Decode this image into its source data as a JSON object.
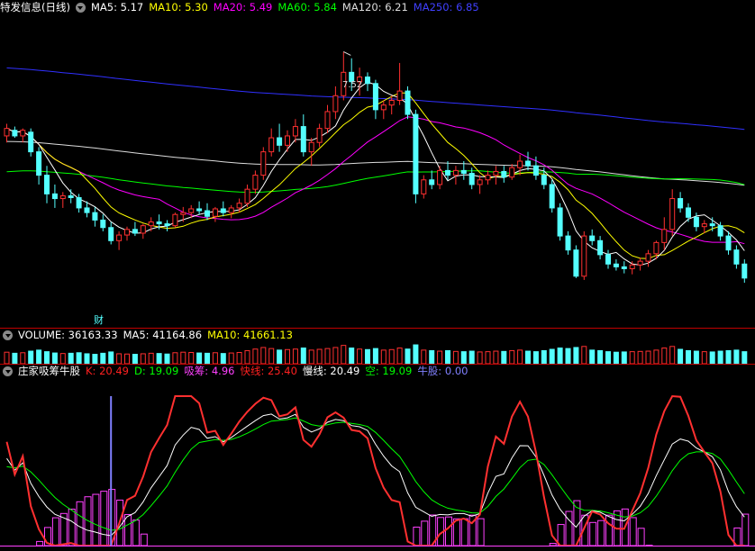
{
  "main_header": {
    "stock_name": "特发信息",
    "period": "(日线)",
    "ma": [
      {
        "label": "MA5: 5.17",
        "color": "#ffffff"
      },
      {
        "label": "MA10: 5.30",
        "color": "#ffff00"
      },
      {
        "label": "MA20: 5.49",
        "color": "#ff00ff"
      },
      {
        "label": "MA60: 5.84",
        "color": "#00ff00"
      },
      {
        "label": "MA120: 6.21",
        "color": "#dddddd"
      },
      {
        "label": "MA250: 6.85",
        "color": "#4040ff"
      }
    ]
  },
  "high_marker": "7.52",
  "finance_marker": "财",
  "volume_header": [
    {
      "label": "VOLUME: 36163.33",
      "color": "#ffffff"
    },
    {
      "label": "MA5: 41164.86",
      "color": "#ffffff"
    },
    {
      "label": "MA10: 41661.13",
      "color": "#ffff00"
    }
  ],
  "indicator_header": [
    {
      "label": "庄家吸筹牛股",
      "color": "#ffffff"
    },
    {
      "label": "K: 20.49",
      "color": "#ff2020"
    },
    {
      "label": "D: 19.09",
      "color": "#00ff00"
    },
    {
      "label": "吸筹: 4.96",
      "color": "#ff40ff"
    },
    {
      "label": "快线: 25.40",
      "color": "#ff2020"
    },
    {
      "label": "慢线: 20.49",
      "color": "#ffffff"
    },
    {
      "label": "空: 19.09",
      "color": "#00ff00"
    },
    {
      "label": "牛股: 0.00",
      "color": "#8080ff"
    }
  ],
  "colors": {
    "up": "#ff3030",
    "down": "#54ffff",
    "border": "#c00000",
    "ma5": "#ffffff",
    "ma10": "#ffff00",
    "ma20": "#ff00ff",
    "ma60": "#00ff00",
    "ma120": "#dddddd",
    "ma250": "#3030ff",
    "bull": "#8080ff",
    "absorb": "#ff40ff"
  },
  "chart_data": {
    "type": "candlestick",
    "candles": [
      [
        6.62,
        6.75,
        6.55,
        6.7
      ],
      [
        6.68,
        6.72,
        6.6,
        6.62
      ],
      [
        6.62,
        6.7,
        6.55,
        6.68
      ],
      [
        6.66,
        6.7,
        6.4,
        6.45
      ],
      [
        6.45,
        6.5,
        6.1,
        6.2
      ],
      [
        6.2,
        6.3,
        5.9,
        6.0
      ],
      [
        6.0,
        6.1,
        5.85,
        5.95
      ],
      [
        5.95,
        6.02,
        5.85,
        5.98
      ],
      [
        5.98,
        6.05,
        5.9,
        5.96
      ],
      [
        5.96,
        6.0,
        5.8,
        5.85
      ],
      [
        5.85,
        5.92,
        5.75,
        5.8
      ],
      [
        5.8,
        5.86,
        5.65,
        5.72
      ],
      [
        5.72,
        5.78,
        5.6,
        5.64
      ],
      [
        5.64,
        5.7,
        5.46,
        5.5
      ],
      [
        5.5,
        5.6,
        5.4,
        5.56
      ],
      [
        5.56,
        5.65,
        5.5,
        5.62
      ],
      [
        5.62,
        5.7,
        5.55,
        5.58
      ],
      [
        5.58,
        5.68,
        5.52,
        5.66
      ],
      [
        5.66,
        5.75,
        5.6,
        5.7
      ],
      [
        5.7,
        5.78,
        5.62,
        5.68
      ],
      [
        5.68,
        5.72,
        5.6,
        5.66
      ],
      [
        5.66,
        5.8,
        5.64,
        5.78
      ],
      [
        5.78,
        5.86,
        5.7,
        5.8
      ],
      [
        5.8,
        5.88,
        5.74,
        5.84
      ],
      [
        5.84,
        5.92,
        5.78,
        5.82
      ],
      [
        5.82,
        5.9,
        5.72,
        5.76
      ],
      [
        5.76,
        5.86,
        5.7,
        5.84
      ],
      [
        5.84,
        5.92,
        5.76,
        5.8
      ],
      [
        5.8,
        5.88,
        5.74,
        5.85
      ],
      [
        5.85,
        5.95,
        5.8,
        5.9
      ],
      [
        5.9,
        6.1,
        5.86,
        6.05
      ],
      [
        6.05,
        6.25,
        6.0,
        6.2
      ],
      [
        6.2,
        6.5,
        6.15,
        6.45
      ],
      [
        6.45,
        6.7,
        6.4,
        6.6
      ],
      [
        6.6,
        6.75,
        6.45,
        6.52
      ],
      [
        6.52,
        6.68,
        6.45,
        6.62
      ],
      [
        6.62,
        6.8,
        6.55,
        6.72
      ],
      [
        6.72,
        6.85,
        6.4,
        6.45
      ],
      [
        6.45,
        6.6,
        6.3,
        6.55
      ],
      [
        6.55,
        6.75,
        6.5,
        6.7
      ],
      [
        6.7,
        6.95,
        6.65,
        6.88
      ],
      [
        6.88,
        7.15,
        6.8,
        7.05
      ],
      [
        7.05,
        7.52,
        7.0,
        7.3
      ],
      [
        7.3,
        7.45,
        7.1,
        7.2
      ],
      [
        7.2,
        7.35,
        7.05,
        7.25
      ],
      [
        7.25,
        7.3,
        7.1,
        7.18
      ],
      [
        7.18,
        7.22,
        6.8,
        6.9
      ],
      [
        6.9,
        7.0,
        6.8,
        6.95
      ],
      [
        6.95,
        7.05,
        6.85,
        7.0
      ],
      [
        7.0,
        7.4,
        6.95,
        7.1
      ],
      [
        7.1,
        7.15,
        6.8,
        6.85
      ],
      [
        6.85,
        6.9,
        5.9,
        6.0
      ],
      [
        6.0,
        6.2,
        5.95,
        6.15
      ],
      [
        6.15,
        6.25,
        6.05,
        6.1
      ],
      [
        6.1,
        6.3,
        6.05,
        6.25
      ],
      [
        6.25,
        6.35,
        6.15,
        6.2
      ],
      [
        6.2,
        6.3,
        6.1,
        6.25
      ],
      [
        6.25,
        6.35,
        6.15,
        6.22
      ],
      [
        6.22,
        6.28,
        6.05,
        6.1
      ],
      [
        6.1,
        6.2,
        6.0,
        6.15
      ],
      [
        6.15,
        6.25,
        6.1,
        6.2
      ],
      [
        6.2,
        6.3,
        6.1,
        6.24
      ],
      [
        6.24,
        6.3,
        6.12,
        6.18
      ],
      [
        6.18,
        6.32,
        6.15,
        6.28
      ],
      [
        6.28,
        6.42,
        6.2,
        6.35
      ],
      [
        6.35,
        6.45,
        6.25,
        6.3
      ],
      [
        6.3,
        6.4,
        6.15,
        6.2
      ],
      [
        6.2,
        6.28,
        6.05,
        6.1
      ],
      [
        6.1,
        6.15,
        5.8,
        5.85
      ],
      [
        5.85,
        5.9,
        5.5,
        5.55
      ],
      [
        5.55,
        5.6,
        5.35,
        5.4
      ],
      [
        5.4,
        5.45,
        5.1,
        5.12
      ],
      [
        5.12,
        5.6,
        5.08,
        5.55
      ],
      [
        5.55,
        5.62,
        5.45,
        5.5
      ],
      [
        5.5,
        5.55,
        5.3,
        5.35
      ],
      [
        5.35,
        5.4,
        5.2,
        5.25
      ],
      [
        5.25,
        5.3,
        5.18,
        5.22
      ],
      [
        5.22,
        5.28,
        5.15,
        5.2
      ],
      [
        5.2,
        5.28,
        5.14,
        5.24
      ],
      [
        5.24,
        5.32,
        5.18,
        5.28
      ],
      [
        5.28,
        5.4,
        5.22,
        5.36
      ],
      [
        5.36,
        5.5,
        5.3,
        5.48
      ],
      [
        5.48,
        5.75,
        5.4,
        5.62
      ],
      [
        5.62,
        6.05,
        5.55,
        5.95
      ],
      [
        5.95,
        6.02,
        5.8,
        5.85
      ],
      [
        5.85,
        5.9,
        5.7,
        5.75
      ],
      [
        5.75,
        5.8,
        5.6,
        5.65
      ],
      [
        5.65,
        5.72,
        5.58,
        5.68
      ],
      [
        5.68,
        5.75,
        5.6,
        5.66
      ],
      [
        5.66,
        5.7,
        5.5,
        5.55
      ],
      [
        5.55,
        5.6,
        5.35,
        5.4
      ],
      [
        5.4,
        5.45,
        5.2,
        5.25
      ],
      [
        5.25,
        5.3,
        5.05,
        5.1
      ]
    ],
    "volume": [
      44,
      40,
      42,
      48,
      52,
      46,
      41,
      39,
      40,
      42,
      38,
      36,
      40,
      45,
      38,
      37,
      36,
      38,
      40,
      39,
      37,
      42,
      44,
      43,
      41,
      40,
      42,
      39,
      41,
      43,
      50,
      56,
      62,
      58,
      52,
      54,
      56,
      60,
      52,
      55,
      58,
      62,
      70,
      60,
      56,
      54,
      58,
      52,
      54,
      60,
      56,
      72,
      52,
      50,
      48,
      50,
      47,
      46,
      48,
      45,
      46,
      48,
      47,
      50,
      52,
      48,
      46,
      50,
      55,
      60,
      58,
      62,
      66,
      52,
      50,
      46,
      44,
      45,
      46,
      47,
      48,
      52,
      60,
      66,
      55,
      50,
      48,
      46,
      45,
      48,
      50,
      52,
      46
    ],
    "ylim": [
      4.8,
      7.9
    ]
  }
}
